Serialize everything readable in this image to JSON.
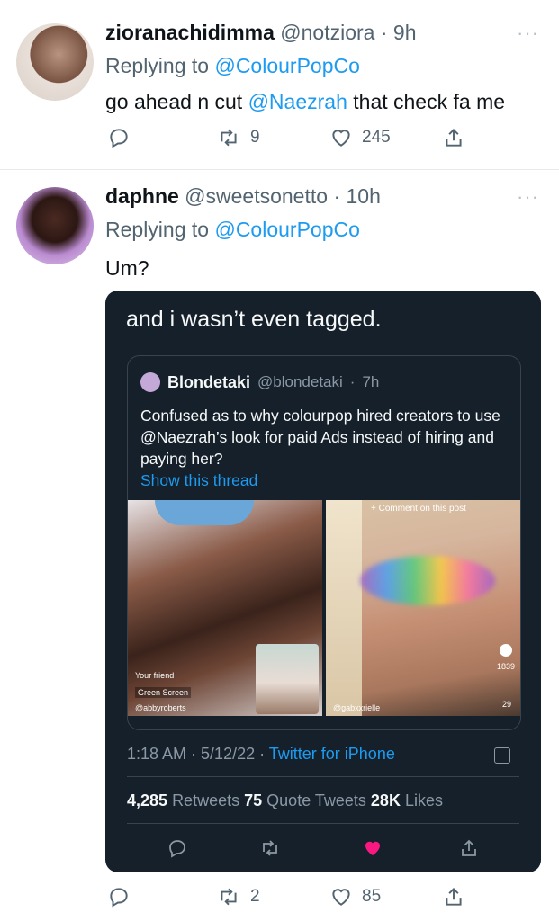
{
  "tweet1": {
    "display_name": "zioranachidimma",
    "handle": "@notziora",
    "time": "9h",
    "replying_prefix": "Replying to",
    "replying_to": "@ColourPopCo",
    "text_before": "go ahead n cut",
    "mention": "@Naezrah",
    "text_after": "that check fa me",
    "retweets": "9",
    "likes": "245",
    "more_label": "···"
  },
  "tweet2": {
    "display_name": "daphne",
    "handle": "@sweetsonetto",
    "time": "10h",
    "replying_prefix": "Replying to",
    "replying_to": "@ColourPopCo",
    "text": "Um?",
    "retweets": "2",
    "likes": "85",
    "more_label": "···"
  },
  "screenshot": {
    "caption": "and i wasn’t even tagged.",
    "quote": {
      "display_name": "Blondetaki",
      "handle": "@blondetaki",
      "time": "7h",
      "body": "Confused as to why colourpop hired creators to use @Naezrah’s look for paid Ads instead of hiring and paying her?",
      "show_thread": "Show this thread",
      "left_overlay_1": "Your friend",
      "left_overlay_2": "Green Screen",
      "left_overlay_3": "@abbyroberts",
      "right_overlay_top": "+ Comment on this post",
      "right_overlay_handle": "@gabxxrielle",
      "right_overlay_count_1": "1839",
      "right_overlay_count_2": "29"
    },
    "time": "1:18 AM",
    "date": "5/12/22",
    "via": "Twitter for iPhone",
    "retweets_count": "4,285",
    "retweets_label": "Retweets",
    "quote_count": "75",
    "quote_label": "Quote Tweets",
    "likes_count": "28K",
    "likes_label": "Likes"
  },
  "colors": {
    "accent": "#1d9bf0",
    "text": "#0f1419",
    "muted": "#536471",
    "dark_bg": "#15202b",
    "like_pink": "#f91880"
  }
}
